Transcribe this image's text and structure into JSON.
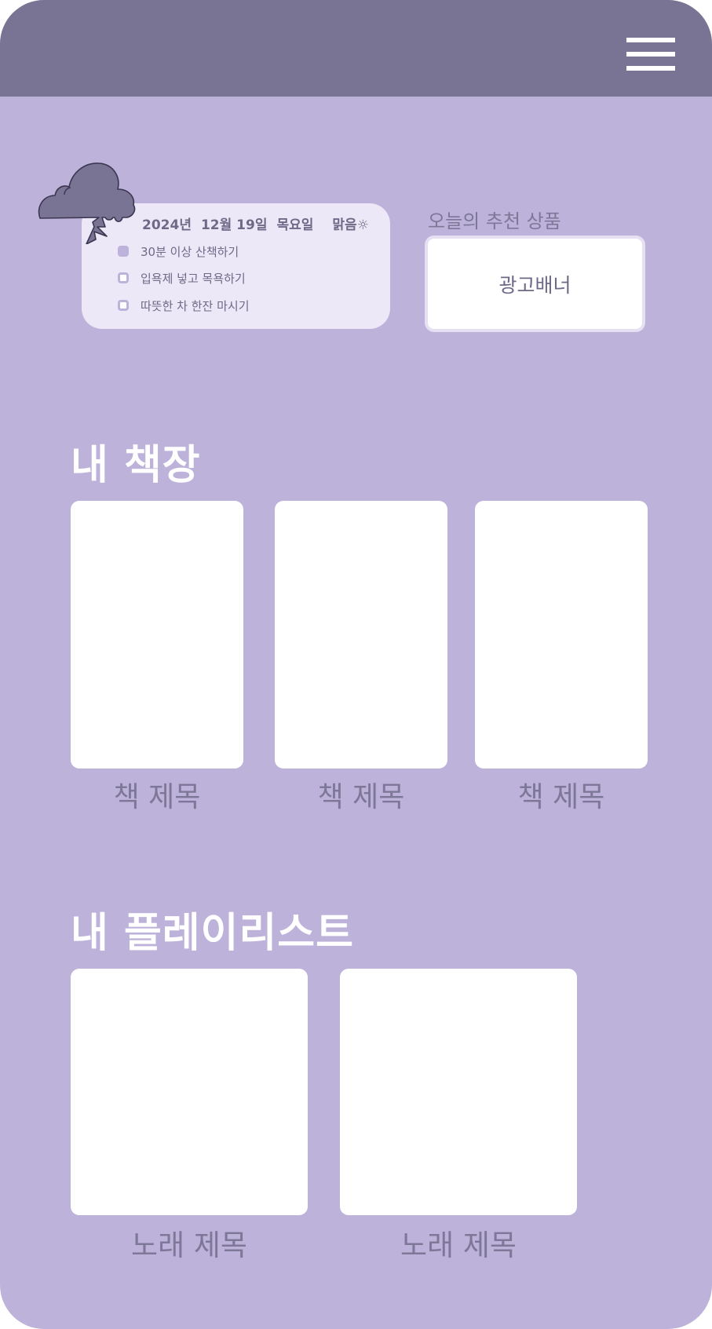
{
  "header": {
    "menu_icon": "hamburger-menu-icon"
  },
  "todo": {
    "weather_icon": "storm-cloud-icon",
    "date": {
      "year": "2024년",
      "day": "12월 19일",
      "weekday": "목요일",
      "weather": "맑음☼"
    },
    "items": [
      {
        "label": "30분 이상 산책하기",
        "checked": true
      },
      {
        "label": "입욕제 넣고 목욕하기",
        "checked": false
      },
      {
        "label": "따뜻한 차 한잔 마시기",
        "checked": false
      }
    ]
  },
  "recommend": {
    "title": "오늘의 추천 상품",
    "banner_label": "광고배너"
  },
  "bookshelf": {
    "title": "내 책장",
    "books": [
      {
        "title": "책 제목"
      },
      {
        "title": "책 제목"
      },
      {
        "title": "책 제목"
      }
    ]
  },
  "playlist": {
    "title": "내 플레이리스트",
    "songs": [
      {
        "title": "노래 제목"
      },
      {
        "title": "노래 제목"
      }
    ]
  },
  "colors": {
    "background": "#bdb2da",
    "header": "#797394",
    "card": "#ece8f7",
    "text": "#7e7898"
  }
}
